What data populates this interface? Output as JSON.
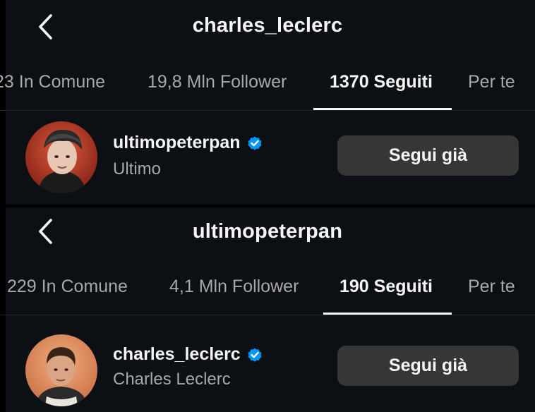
{
  "top": {
    "title": "charles_leclerc",
    "tabs": [
      {
        "label": "23 In Comune"
      },
      {
        "label": "19,8 Mln Follower"
      },
      {
        "label": "1370 Seguiti",
        "active": true
      },
      {
        "label": "Per te"
      }
    ],
    "user": {
      "username": "ultimopeterpan",
      "full_name": "Ultimo",
      "verified": true,
      "button_label": "Segui già"
    }
  },
  "bottom": {
    "title": "ultimopeterpan",
    "tabs": [
      {
        "label": "229 In Comune"
      },
      {
        "label": "4,1 Mln Follower"
      },
      {
        "label": "190 Seguiti",
        "active": true
      },
      {
        "label": "Per te"
      }
    ],
    "user": {
      "username": "charles_leclerc",
      "full_name": "Charles Leclerc",
      "verified": true,
      "button_label": "Segui già"
    }
  },
  "colors": {
    "background": "#0c1014",
    "text_primary": "#f5f5f5",
    "text_secondary": "#a8a8a8",
    "button_bg": "#363636",
    "verified_blue": "#0095f6"
  }
}
